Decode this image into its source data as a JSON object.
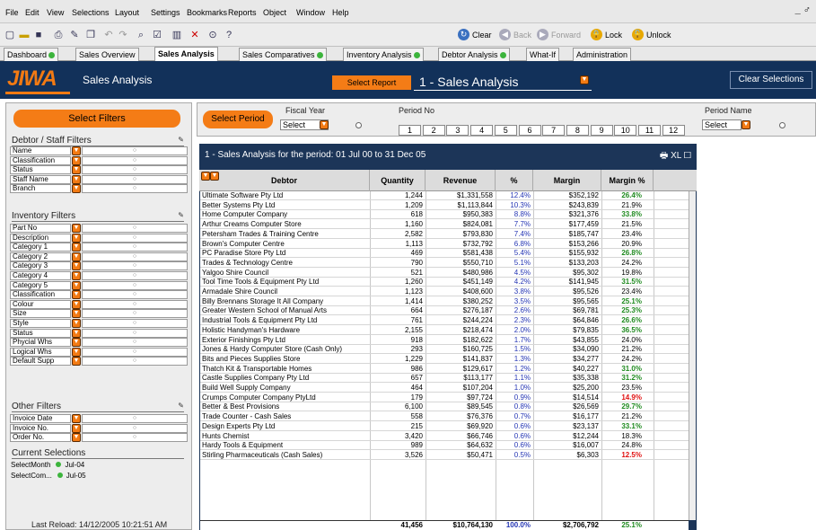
{
  "menu": [
    "File",
    "Edit",
    "View",
    "Selections",
    "Layout",
    "Settings",
    "Bookmarks",
    "Reports",
    "Object",
    "Window",
    "Help"
  ],
  "window_controls": "_ ♂",
  "toolbar": {
    "clear": "Clear",
    "back": "Back",
    "forward": "Forward",
    "lock": "Lock",
    "unlock": "Unlock"
  },
  "tabs": [
    {
      "label": "Dashboard",
      "dot": true
    },
    {
      "label": "Sales Overview",
      "dot": false
    },
    {
      "label": "Sales Analysis",
      "dot": false,
      "active": true
    },
    {
      "label": "Sales Comparatives",
      "dot": true
    },
    {
      "label": "Inventory Analysis",
      "dot": true
    },
    {
      "label": "Debtor Analysis",
      "dot": true
    },
    {
      "label": "What-If",
      "dot": false
    },
    {
      "label": "Administration",
      "dot": false
    }
  ],
  "header": {
    "logo": "JIWA",
    "title": "Sales Analysis",
    "select_report": "Select Report",
    "report_value": "1 - Sales Analysis",
    "clear_selections": "Clear Selections"
  },
  "left": {
    "select_filters": "Select Filters",
    "debtor_title": "Debtor / Staff Filters",
    "debtor_filters": [
      "Name",
      "Classification",
      "Status",
      "Staff Name",
      "Branch"
    ],
    "inventory_title": "Inventory Filters",
    "inventory_filters": [
      "Part No",
      "Description",
      "Category 1",
      "Category 2",
      "Category 3",
      "Category 4",
      "Category 5",
      "Classification",
      "Colour",
      "Size",
      "Style",
      "Status",
      "Phycial Whs",
      "Logical Whs",
      "Default Supp"
    ],
    "other_title": "Other Filters",
    "other_filters": [
      "Invoice Date",
      "Invoice No.",
      "Order No."
    ],
    "current_title": "Current Selections",
    "current": [
      {
        "field": "SelectMonth",
        "value": "Jul-04"
      },
      {
        "field": "SelectCom...",
        "value": "Jul-05"
      }
    ],
    "last_reload": "Last Reload: 14/12/2005 10:21:51 AM"
  },
  "period": {
    "select_period": "Select Period",
    "fiscal_year_label": "Fiscal Year",
    "fiscal_year_value": "Select",
    "period_no_label": "Period No",
    "period_numbers": [
      "1",
      "2",
      "3",
      "4",
      "5",
      "6",
      "7",
      "8",
      "9",
      "10",
      "11",
      "12"
    ],
    "period_name_label": "Period Name",
    "period_name_value": "Select"
  },
  "grid": {
    "title": "1 - Sales Analysis for the period: 01 Jul 00 to 31 Dec 05",
    "icons": "🖶 XL ☐",
    "columns": [
      "Debtor",
      "Quantity",
      "Revenue",
      "%",
      "Margin",
      "Margin %"
    ],
    "rows": [
      [
        "Ultimate Software Pty Ltd",
        "1,244",
        "$1,331,558",
        "12.4%",
        "$352,192",
        "26.4%"
      ],
      [
        "Better Systems Pty Ltd",
        "1,209",
        "$1,113,844",
        "10.3%",
        "$243,839",
        "21.9%"
      ],
      [
        "Home Computer Company",
        "618",
        "$950,383",
        "8.8%",
        "$321,376",
        "33.8%"
      ],
      [
        "Arthur Creams Computer Store",
        "1,160",
        "$824,081",
        "7.7%",
        "$177,459",
        "21.5%"
      ],
      [
        "Petersham Trades & Training Centre",
        "2,582",
        "$793,830",
        "7.4%",
        "$185,747",
        "23.4%"
      ],
      [
        "Brown's Computer Centre",
        "1,113",
        "$732,792",
        "6.8%",
        "$153,266",
        "20.9%"
      ],
      [
        "PC Paradise Store  Pty Ltd",
        "469",
        "$581,438",
        "5.4%",
        "$155,932",
        "26.8%"
      ],
      [
        "Trades & Technology Centre",
        "790",
        "$550,710",
        "5.1%",
        "$133,203",
        "24.2%"
      ],
      [
        "Yalgoo Shire Council",
        "521",
        "$480,986",
        "4.5%",
        "$95,302",
        "19.8%"
      ],
      [
        "Tool Time Tools & Equipment Pty Ltd",
        "1,260",
        "$451,149",
        "4.2%",
        "$141,945",
        "31.5%"
      ],
      [
        "Armadale Shire Council",
        "1,123",
        "$408,600",
        "3.8%",
        "$95,526",
        "23.4%"
      ],
      [
        "Billy Brennans Storage It All Company",
        "1,414",
        "$380,252",
        "3.5%",
        "$95,565",
        "25.1%"
      ],
      [
        "Greater Western School of Manual Arts",
        "664",
        "$276,187",
        "2.6%",
        "$69,781",
        "25.3%"
      ],
      [
        "Industrial Tools & Equipment Pty Ltd",
        "761",
        "$244,224",
        "2.3%",
        "$64,846",
        "26.6%"
      ],
      [
        "Holistic Handyman's Hardware",
        "2,155",
        "$218,474",
        "2.0%",
        "$79,835",
        "36.5%"
      ],
      [
        "Exterior Finishings Pty Ltd",
        "918",
        "$182,622",
        "1.7%",
        "$43,855",
        "24.0%"
      ],
      [
        "Jones & Hardy Computer Store (Cash Only)",
        "293",
        "$160,725",
        "1.5%",
        "$34,090",
        "21.2%"
      ],
      [
        "Bits and Pieces Supplies Store",
        "1,229",
        "$141,837",
        "1.3%",
        "$34,277",
        "24.2%"
      ],
      [
        "Thatch Kit & Transportable Homes",
        "986",
        "$129,617",
        "1.2%",
        "$40,227",
        "31.0%"
      ],
      [
        "Castle Supplies Company Pty Ltd",
        "657",
        "$113,177",
        "1.1%",
        "$35,338",
        "31.2%"
      ],
      [
        "Build Well Supply Company",
        "464",
        "$107,204",
        "1.0%",
        "$25,200",
        "23.5%"
      ],
      [
        "Crumps Computer Company PtyLtd",
        "179",
        "$97,724",
        "0.9%",
        "$14,514",
        "14.9%"
      ],
      [
        "Better & Best Provisions",
        "6,100",
        "$89,545",
        "0.8%",
        "$26,569",
        "29.7%"
      ],
      [
        "Trade Counter - Cash Sales",
        "558",
        "$76,376",
        "0.7%",
        "$16,177",
        "21.2%"
      ],
      [
        "Design Experts Pty Ltd",
        "215",
        "$69,920",
        "0.6%",
        "$23,137",
        "33.1%"
      ],
      [
        "Hunts Chemist",
        "3,420",
        "$66,746",
        "0.6%",
        "$12,244",
        "18.3%"
      ],
      [
        "Hardy Tools & Equipment",
        "989",
        "$64,632",
        "0.6%",
        "$16,007",
        "24.8%"
      ],
      [
        "Stirling Pharmaceuticals (Cash Sales)",
        "3,526",
        "$50,471",
        "0.5%",
        "$6,303",
        "12.5%"
      ]
    ],
    "totals": {
      "quantity": "41,456",
      "revenue": "$10,764,130",
      "percent": "100.0%",
      "margin": "$2,706,792",
      "margin_pct": "25.1%"
    }
  },
  "colors": {
    "navy": "#12315a",
    "orange": "#f47c16",
    "green_pct": "#1f8a1f",
    "red_pct": "#e01010",
    "blue_pct": "#2536b4"
  }
}
